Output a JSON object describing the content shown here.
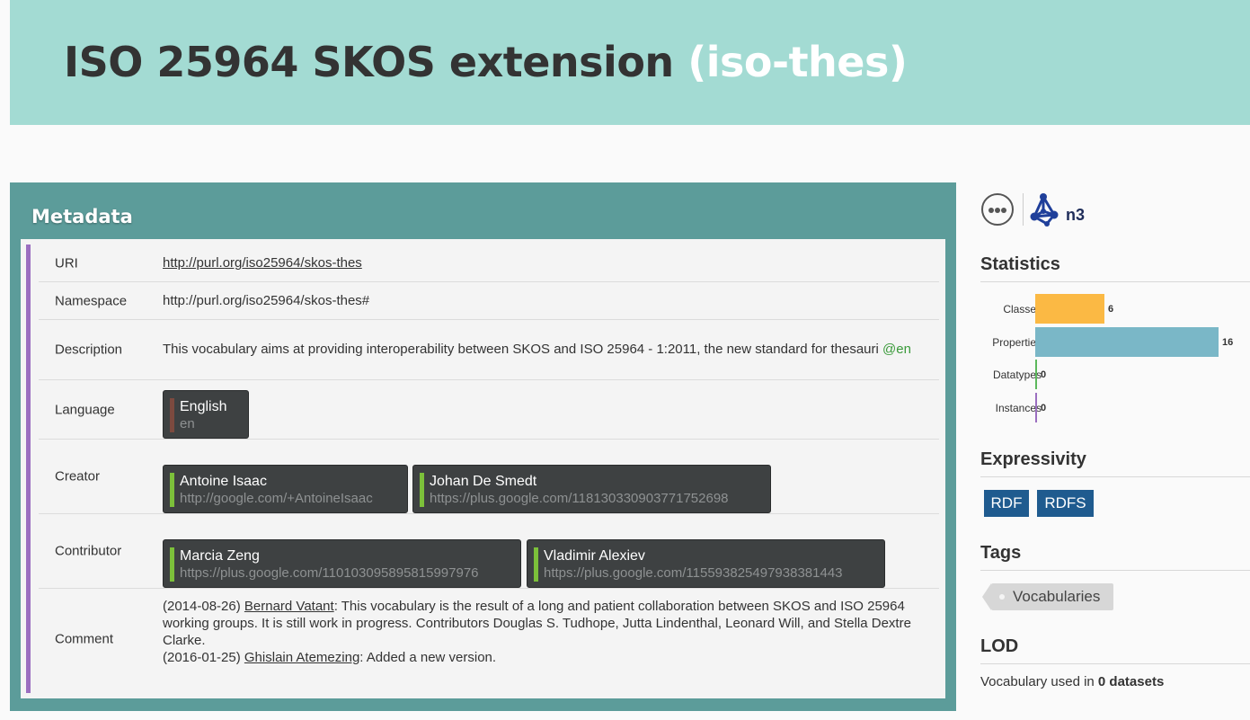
{
  "header": {
    "title": "ISO 25964 SKOS extension",
    "prefix": "(iso-thes)"
  },
  "metadata": {
    "title": "Metadata",
    "uri": {
      "label": "URI",
      "value": "http://purl.org/iso25964/skos-thes"
    },
    "namespace": {
      "label": "Namespace",
      "value": "http://purl.org/iso25964/skos-thes#"
    },
    "description": {
      "label": "Description",
      "value": "This vocabulary aims at providing interoperability between SKOS and ISO 25964 - 1:2011, the new standard for thesauri",
      "lang": "@en"
    },
    "language": {
      "label": "Language",
      "items": [
        {
          "name": "English",
          "code": "en"
        }
      ]
    },
    "creator": {
      "label": "Creator",
      "items": [
        {
          "name": "Antoine Isaac",
          "url": "http://google.com/+AntoineIsaac"
        },
        {
          "name": "Johan De Smedt",
          "url": "https://plus.google.com/118130330903771752698"
        }
      ]
    },
    "contributor": {
      "label": "Contributor",
      "items": [
        {
          "name": "Marcia Zeng",
          "url": "https://plus.google.com/110103095895815997976"
        },
        {
          "name": "Vladimir Alexiev",
          "url": "https://plus.google.com/115593825497938381443"
        }
      ]
    },
    "comment": {
      "label": "Comment",
      "entries": [
        {
          "date": "(2014-08-26)",
          "author": "Bernard Vatant",
          "text": ": This vocabulary is the result of a long and patient collaboration between SKOS and ISO 25964 working groups. It is still work in progress. Contributors Douglas S. Tudhope, Jutta Lindenthal, Leonard Will, and Stella Dextre Clarke."
        },
        {
          "date": "(2016-01-25)",
          "author": "Ghislain Atemezing",
          "text": ": Added a new version."
        }
      ]
    }
  },
  "sidebar": {
    "icons": [
      "more-icon",
      "n3-format-icon"
    ],
    "n3_label": "n3",
    "statistics": {
      "title": "Statistics",
      "items": [
        {
          "label": "Classes",
          "value": 6,
          "color": "#fbb944"
        },
        {
          "label": "Properties",
          "value": 16,
          "color": "#7ab7c7"
        },
        {
          "label": "Datatypes",
          "value": 0,
          "color": "#5cb85c"
        },
        {
          "label": "Instances",
          "value": 0,
          "color": "#9b6fc0"
        }
      ]
    },
    "expressivity": {
      "title": "Expressivity",
      "badges": [
        "RDF",
        "RDFS"
      ]
    },
    "tags": {
      "title": "Tags",
      "items": [
        "Vocabularies"
      ]
    },
    "lod": {
      "title": "LOD",
      "text_before": "Vocabulary used in ",
      "count": "0 datasets"
    }
  },
  "colors": {
    "banner": "#a3dbd3",
    "metadata_frame": "#5c9c9a",
    "accent_bar": "#9b6fc0",
    "badge": "#1f5b8f",
    "lang_tag": "#3a9a3a"
  }
}
